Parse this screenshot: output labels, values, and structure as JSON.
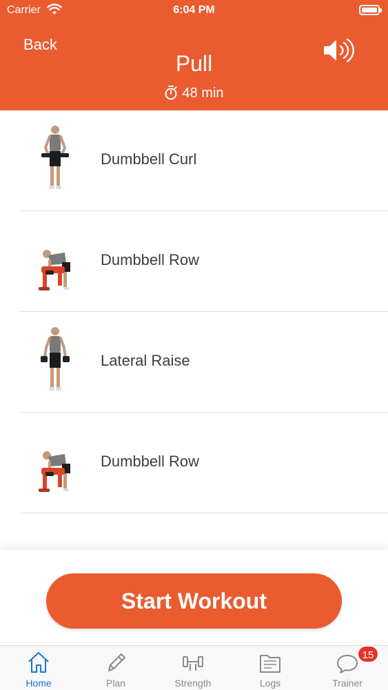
{
  "status_bar": {
    "carrier": "Carrier",
    "time": "6:04 PM"
  },
  "header": {
    "back_label": "Back",
    "title": "Pull",
    "duration": "48 min",
    "color": "#ea5b30"
  },
  "exercises": [
    {
      "name": "Dumbbell Curl",
      "pose": "standing-curl"
    },
    {
      "name": "Dumbbell Row",
      "pose": "bent-over-row"
    },
    {
      "name": "Lateral Raise",
      "pose": "standing-raise"
    },
    {
      "name": "Dumbbell Row",
      "pose": "bent-over-row"
    }
  ],
  "start_button": {
    "label": "Start Workout"
  },
  "tabs": [
    {
      "label": "Home",
      "icon": "home-icon",
      "active": true
    },
    {
      "label": "Plan",
      "icon": "pencil-icon",
      "active": false
    },
    {
      "label": "Strength",
      "icon": "dumbbell-icon",
      "active": false
    },
    {
      "label": "Logs",
      "icon": "folder-icon",
      "active": false
    },
    {
      "label": "Trainer",
      "icon": "chat-icon",
      "active": false
    }
  ],
  "trainer_badge": "15",
  "colors": {
    "accent": "#ea5b30",
    "tab_active": "#1a73d9",
    "tab_inactive": "#8a8a8a",
    "badge": "#e8332a"
  }
}
